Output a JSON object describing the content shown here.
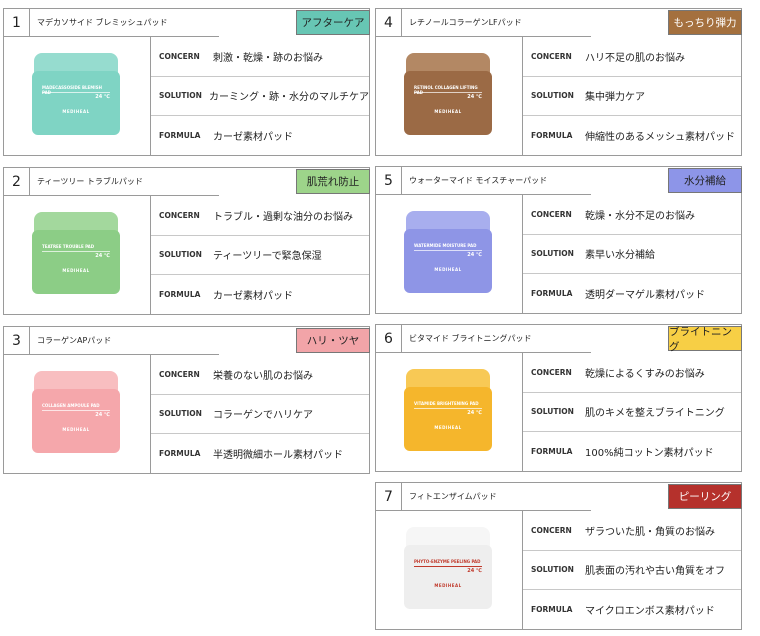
{
  "cards": [
    {
      "num": "1",
      "name": "マデカソサイド ブレミッシュパッド",
      "badge": "アフターケア",
      "badge_color": "#67c6b4",
      "concern_label": "CONCERN",
      "concern": "刺激・乾燥・跡のお悩み",
      "solution_label": "SOLUTION",
      "solution": "カーミング・跡・水分のマルチケア",
      "formula_label": "FORMULA",
      "formula": "カーゼ素材パッド",
      "product": {
        "title": "MADECASSOSIDE BLEMISH PAD",
        "count": "24 ℃",
        "brand": "MEDIHEAL",
        "color": "#7fd4c4",
        "lid": "#96dccf"
      }
    },
    {
      "num": "2",
      "name": "ティーツリー トラブルパッド",
      "badge": "肌荒れ防止",
      "badge_color": "#9dd48a",
      "concern_label": "CONCERN",
      "concern": "トラブル・過剰な油分のお悩み",
      "solution_label": "SOLUTION",
      "solution": "ティーツリーで緊急保湿",
      "formula_label": "FORMULA",
      "formula": "カーゼ素材パッド",
      "product": {
        "title": "TEATREE TROUBLE PAD",
        "count": "24 ℃",
        "brand": "MEDIHEAL",
        "color": "#8ccd86",
        "lid": "#a3d89d"
      }
    },
    {
      "num": "3",
      "name": "コラーゲンAPパッド",
      "badge": "ハリ・ツヤ",
      "badge_color": "#f2a4a8",
      "concern_label": "CONCERN",
      "concern": "栄養のない肌のお悩み",
      "solution_label": "SOLUTION",
      "solution": "コラーゲンでハリケア",
      "formula_label": "FORMULA",
      "formula": "半透明微細ホール素材パッド",
      "product": {
        "title": "COLLAGEN AMPOULE PAD",
        "count": "24 ℃",
        "brand": "MEDIHEAL",
        "color": "#f5a7ab",
        "lid": "#f8bec0"
      }
    },
    {
      "num": "4",
      "name": "レチノールコラーゲンLFパッド",
      "badge": "もっちり弾力",
      "badge_color": "#a4703e",
      "concern_label": "CONCERN",
      "concern": "ハリ不足の肌のお悩み",
      "solution_label": "SOLUTION",
      "solution": "集中弾力ケア",
      "formula_label": "FORMULA",
      "formula": "伸縮性のあるメッシュ素材パッド",
      "product": {
        "title": "RETINOL COLLAGEN LIFTING PAD",
        "count": "24 ℃",
        "brand": "MEDIHEAL",
        "color": "#9b6a45",
        "lid": "#b38864"
      }
    },
    {
      "num": "5",
      "name": "ウォーターマイド モイスチャーパッド",
      "badge": "水分補給",
      "badge_color": "#8d95e8",
      "concern_label": "CONCERN",
      "concern": "乾燥・水分不足のお悩み",
      "solution_label": "SOLUTION",
      "solution": "素早い水分補給",
      "formula_label": "FORMULA",
      "formula": "透明ダーマゲル素材パッド",
      "product": {
        "title": "WATERMIDE MOISTURE PAD",
        "count": "24 ℃",
        "brand": "MEDIHEAL",
        "color": "#8e95e6",
        "lid": "#a8aeee"
      }
    },
    {
      "num": "6",
      "name": "ビタマイド ブライトニングパッド",
      "badge": "ブライトニング",
      "badge_color": "#f7cf45",
      "concern_label": "CONCERN",
      "concern": "乾燥によるくすみのお悩み",
      "solution_label": "SOLUTION",
      "solution": "肌のキメを整えブライトニング",
      "formula_label": "FORMULA",
      "formula": "100%純コットン素材パッド",
      "product": {
        "title": "VITAMIDE BRIGHTENING PAD",
        "count": "24 ℃",
        "brand": "MEDIHEAL",
        "color": "#f5b62c",
        "lid": "#f8c955"
      }
    },
    {
      "num": "7",
      "name": "フィトエンザイムパッド",
      "badge": "ピーリング",
      "badge_color": "#b5312c",
      "concern_label": "CONCERN",
      "concern": "ザラついた肌・角質のお悩み",
      "solution_label": "SOLUTION",
      "solution": "肌表面の汚れや古い角質をオフ",
      "formula_label": "FORMULA",
      "formula": "マイクロエンボス素材パッド",
      "product": {
        "title": "PHYTO-ENZYME PEELING PAD",
        "count": "24 ℃",
        "brand": "MEDIHEAL",
        "color": "#eeeeee",
        "lid": "#f6f6f6"
      }
    }
  ]
}
